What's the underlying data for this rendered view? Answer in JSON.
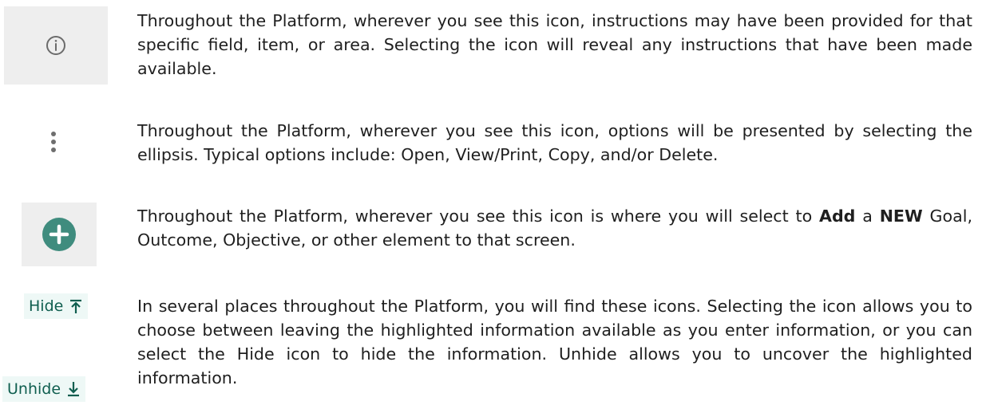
{
  "rows": [
    {
      "icon": "info-circle-icon",
      "text": "Throughout the Platform, wherever you see this icon, instructions may have been provided for that specific field, item, or area. Selecting the icon will reveal any instructions that have been made available."
    },
    {
      "icon": "more-vertical-icon",
      "text": "Throughout the Platform, wherever you see this icon, options will be presented by selecting the ellipsis. Typical options include: Open, View/Print, Copy, and/or Delete."
    },
    {
      "icon": "add-circle-icon",
      "text_before": "Throughout the Platform, wherever you see this icon is where you will select to ",
      "bold_add": "Add",
      "text_mid": " a ",
      "bold_new": "NEW",
      "text_after": " Goal, Outcome, Objective, or other element to that screen."
    },
    {
      "icons": [
        "hide-icon",
        "unhide-icon"
      ],
      "hide_label": "Hide",
      "unhide_label": "Unhide",
      "text": "In several places throughout the Platform, you will find these icons. Selecting the icon allows you to choose between leaving the highlighted information available as you enter information, or you can select the Hide icon to hide the information. Unhide allows you to uncover the highlighted information."
    }
  ],
  "colors": {
    "icon_bg": "#eeeeee",
    "add_button": "#3f8c7e",
    "hide_bg": "#eef8f6",
    "hide_text": "#0f5e4f",
    "info_icon": "#6b6b6b"
  }
}
